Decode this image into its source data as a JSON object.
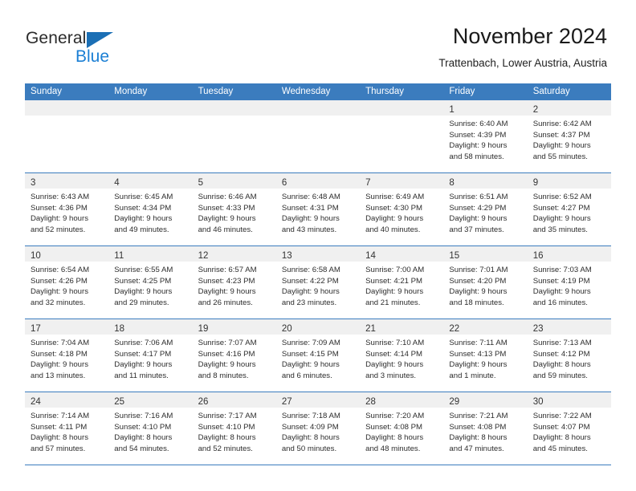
{
  "brand": {
    "name_part1": "General",
    "name_part2": "Blue",
    "triangle_icon": "blue-triangle-icon",
    "accent_color": "#1b7fd4",
    "header_color": "#3b7cbe"
  },
  "header": {
    "title": "November 2024",
    "subtitle": "Trattenbach, Lower Austria, Austria"
  },
  "calendar": {
    "weekday_headers": [
      "Sunday",
      "Monday",
      "Tuesday",
      "Wednesday",
      "Thursday",
      "Friday",
      "Saturday"
    ],
    "weeks": [
      [
        {
          "day": "",
          "lines": []
        },
        {
          "day": "",
          "lines": []
        },
        {
          "day": "",
          "lines": []
        },
        {
          "day": "",
          "lines": []
        },
        {
          "day": "",
          "lines": []
        },
        {
          "day": "1",
          "lines": [
            "Sunrise: 6:40 AM",
            "Sunset: 4:39 PM",
            "Daylight: 9 hours",
            "and 58 minutes."
          ]
        },
        {
          "day": "2",
          "lines": [
            "Sunrise: 6:42 AM",
            "Sunset: 4:37 PM",
            "Daylight: 9 hours",
            "and 55 minutes."
          ]
        }
      ],
      [
        {
          "day": "3",
          "lines": [
            "Sunrise: 6:43 AM",
            "Sunset: 4:36 PM",
            "Daylight: 9 hours",
            "and 52 minutes."
          ]
        },
        {
          "day": "4",
          "lines": [
            "Sunrise: 6:45 AM",
            "Sunset: 4:34 PM",
            "Daylight: 9 hours",
            "and 49 minutes."
          ]
        },
        {
          "day": "5",
          "lines": [
            "Sunrise: 6:46 AM",
            "Sunset: 4:33 PM",
            "Daylight: 9 hours",
            "and 46 minutes."
          ]
        },
        {
          "day": "6",
          "lines": [
            "Sunrise: 6:48 AM",
            "Sunset: 4:31 PM",
            "Daylight: 9 hours",
            "and 43 minutes."
          ]
        },
        {
          "day": "7",
          "lines": [
            "Sunrise: 6:49 AM",
            "Sunset: 4:30 PM",
            "Daylight: 9 hours",
            "and 40 minutes."
          ]
        },
        {
          "day": "8",
          "lines": [
            "Sunrise: 6:51 AM",
            "Sunset: 4:29 PM",
            "Daylight: 9 hours",
            "and 37 minutes."
          ]
        },
        {
          "day": "9",
          "lines": [
            "Sunrise: 6:52 AM",
            "Sunset: 4:27 PM",
            "Daylight: 9 hours",
            "and 35 minutes."
          ]
        }
      ],
      [
        {
          "day": "10",
          "lines": [
            "Sunrise: 6:54 AM",
            "Sunset: 4:26 PM",
            "Daylight: 9 hours",
            "and 32 minutes."
          ]
        },
        {
          "day": "11",
          "lines": [
            "Sunrise: 6:55 AM",
            "Sunset: 4:25 PM",
            "Daylight: 9 hours",
            "and 29 minutes."
          ]
        },
        {
          "day": "12",
          "lines": [
            "Sunrise: 6:57 AM",
            "Sunset: 4:23 PM",
            "Daylight: 9 hours",
            "and 26 minutes."
          ]
        },
        {
          "day": "13",
          "lines": [
            "Sunrise: 6:58 AM",
            "Sunset: 4:22 PM",
            "Daylight: 9 hours",
            "and 23 minutes."
          ]
        },
        {
          "day": "14",
          "lines": [
            "Sunrise: 7:00 AM",
            "Sunset: 4:21 PM",
            "Daylight: 9 hours",
            "and 21 minutes."
          ]
        },
        {
          "day": "15",
          "lines": [
            "Sunrise: 7:01 AM",
            "Sunset: 4:20 PM",
            "Daylight: 9 hours",
            "and 18 minutes."
          ]
        },
        {
          "day": "16",
          "lines": [
            "Sunrise: 7:03 AM",
            "Sunset: 4:19 PM",
            "Daylight: 9 hours",
            "and 16 minutes."
          ]
        }
      ],
      [
        {
          "day": "17",
          "lines": [
            "Sunrise: 7:04 AM",
            "Sunset: 4:18 PM",
            "Daylight: 9 hours",
            "and 13 minutes."
          ]
        },
        {
          "day": "18",
          "lines": [
            "Sunrise: 7:06 AM",
            "Sunset: 4:17 PM",
            "Daylight: 9 hours",
            "and 11 minutes."
          ]
        },
        {
          "day": "19",
          "lines": [
            "Sunrise: 7:07 AM",
            "Sunset: 4:16 PM",
            "Daylight: 9 hours",
            "and 8 minutes."
          ]
        },
        {
          "day": "20",
          "lines": [
            "Sunrise: 7:09 AM",
            "Sunset: 4:15 PM",
            "Daylight: 9 hours",
            "and 6 minutes."
          ]
        },
        {
          "day": "21",
          "lines": [
            "Sunrise: 7:10 AM",
            "Sunset: 4:14 PM",
            "Daylight: 9 hours",
            "and 3 minutes."
          ]
        },
        {
          "day": "22",
          "lines": [
            "Sunrise: 7:11 AM",
            "Sunset: 4:13 PM",
            "Daylight: 9 hours",
            "and 1 minute."
          ]
        },
        {
          "day": "23",
          "lines": [
            "Sunrise: 7:13 AM",
            "Sunset: 4:12 PM",
            "Daylight: 8 hours",
            "and 59 minutes."
          ]
        }
      ],
      [
        {
          "day": "24",
          "lines": [
            "Sunrise: 7:14 AM",
            "Sunset: 4:11 PM",
            "Daylight: 8 hours",
            "and 57 minutes."
          ]
        },
        {
          "day": "25",
          "lines": [
            "Sunrise: 7:16 AM",
            "Sunset: 4:10 PM",
            "Daylight: 8 hours",
            "and 54 minutes."
          ]
        },
        {
          "day": "26",
          "lines": [
            "Sunrise: 7:17 AM",
            "Sunset: 4:10 PM",
            "Daylight: 8 hours",
            "and 52 minutes."
          ]
        },
        {
          "day": "27",
          "lines": [
            "Sunrise: 7:18 AM",
            "Sunset: 4:09 PM",
            "Daylight: 8 hours",
            "and 50 minutes."
          ]
        },
        {
          "day": "28",
          "lines": [
            "Sunrise: 7:20 AM",
            "Sunset: 4:08 PM",
            "Daylight: 8 hours",
            "and 48 minutes."
          ]
        },
        {
          "day": "29",
          "lines": [
            "Sunrise: 7:21 AM",
            "Sunset: 4:08 PM",
            "Daylight: 8 hours",
            "and 47 minutes."
          ]
        },
        {
          "day": "30",
          "lines": [
            "Sunrise: 7:22 AM",
            "Sunset: 4:07 PM",
            "Daylight: 8 hours",
            "and 45 minutes."
          ]
        }
      ]
    ]
  }
}
